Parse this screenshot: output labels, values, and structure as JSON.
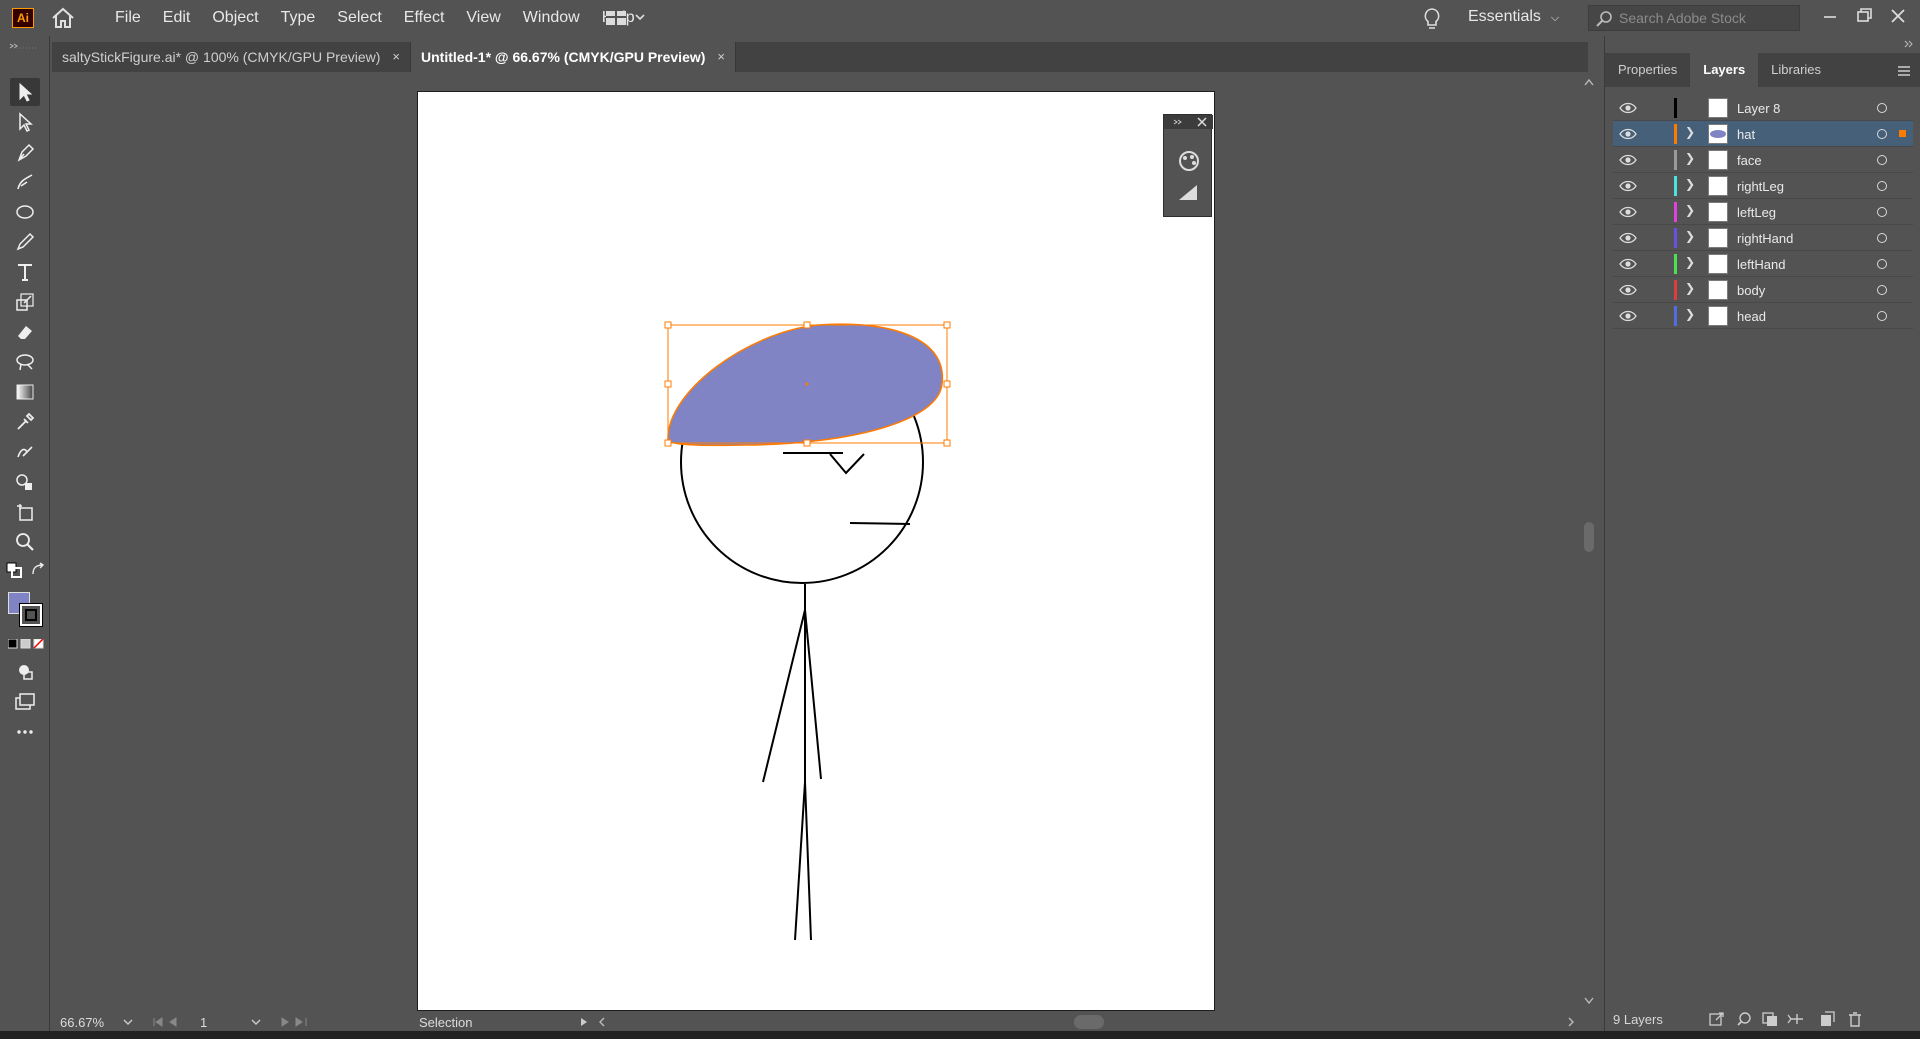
{
  "app": {
    "logo": "Ai"
  },
  "menu": [
    "File",
    "Edit",
    "Object",
    "Type",
    "Select",
    "Effect",
    "View",
    "Window",
    "Help"
  ],
  "workspace": "Essentials",
  "search": {
    "placeholder": "Search Adobe Stock"
  },
  "tabs": [
    {
      "label": "saltyStickFigure.ai* @ 100% (CMYK/GPU Preview)",
      "active": false
    },
    {
      "label": "Untitled-1* @ 66.67% (CMYK/GPU Preview)",
      "active": true
    }
  ],
  "tab_close": "×",
  "panel_tabs": [
    "Properties",
    "Layers",
    "Libraries"
  ],
  "layers": [
    {
      "name": "Layer 8",
      "color": "#000000",
      "expandable": false,
      "selected": false
    },
    {
      "name": "hat",
      "color": "#ff7b00",
      "expandable": true,
      "selected": true
    },
    {
      "name": "face",
      "color": "#9a9a9a",
      "expandable": true,
      "selected": false
    },
    {
      "name": "rightLeg",
      "color": "#4fe0e0",
      "expandable": true,
      "selected": false
    },
    {
      "name": "leftLeg",
      "color": "#e040e0",
      "expandable": true,
      "selected": false
    },
    {
      "name": "rightHand",
      "color": "#6a4fe0",
      "expandable": true,
      "selected": false
    },
    {
      "name": "leftHand",
      "color": "#4fe04f",
      "expandable": true,
      "selected": false
    },
    {
      "name": "body",
      "color": "#e03c3c",
      "expandable": true,
      "selected": false
    },
    {
      "name": "head",
      "color": "#4f6fe0",
      "expandable": true,
      "selected": false
    }
  ],
  "layers_count": "9 Layers",
  "status": {
    "zoom": "66.67%",
    "artboard_number": "1",
    "tool_name": "Selection"
  },
  "colors": {
    "hat_fill": "#8084c4",
    "selection": "#ff7b00",
    "fill_swatch": "#8084c4"
  }
}
